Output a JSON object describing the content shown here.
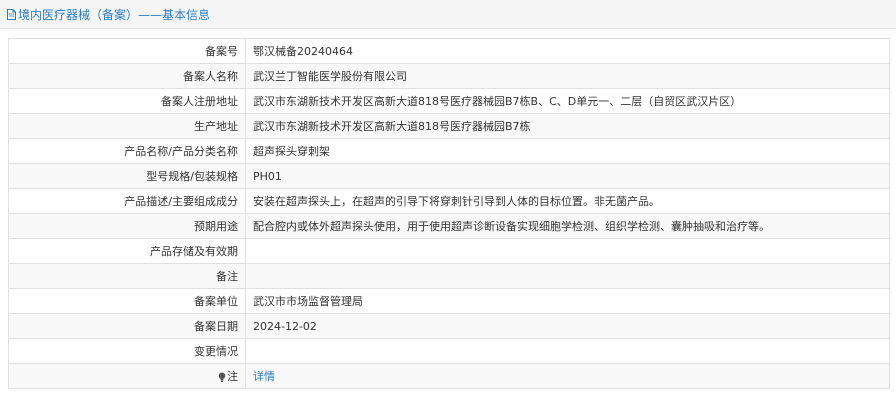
{
  "header": {
    "title": "境内医疗器械（备案）——基本信息",
    "icon": "document-icon",
    "color": "#2a7dc0"
  },
  "fields": {
    "record_no": {
      "label": "备案号",
      "value": "鄂汉械备20240464"
    },
    "filer_name": {
      "label": "备案人名称",
      "value": "武汉兰丁智能医学股份有限公司"
    },
    "filer_address": {
      "label": "备案人注册地址",
      "value": "武汉市东湖新技术开发区高新大道818号医疗器械园B7栋B、C、D单元一、二层（自贸区武汉片区）"
    },
    "production_address": {
      "label": "生产地址",
      "value": "武汉市东湖新技术开发区高新大道818号医疗器械园B7栋"
    },
    "product_name": {
      "label": "产品名称/产品分类名称",
      "value": "超声探头穿刺架"
    },
    "model_spec": {
      "label": "型号规格/包装规格",
      "value": "PH01"
    },
    "description": {
      "label": "产品描述/主要组成成分",
      "value": "安装在超声探头上，在超声的引导下将穿刺针引导到人体的目标位置。非无菌产品。"
    },
    "intended_use": {
      "label": "预期用途",
      "value": "配合腔内或体外超声探头使用，用于使用超声诊断设备实现细胞学检测、组织学检测、囊肿抽吸和治疗等。"
    },
    "storage": {
      "label": "产品存储及有效期",
      "value": ""
    },
    "remarks": {
      "label": "备注",
      "value": ""
    },
    "record_unit": {
      "label": "备案单位",
      "value": "武汉市市场监督管理局"
    },
    "record_date": {
      "label": "备案日期",
      "value": "2024-12-02"
    },
    "changes": {
      "label": "变更情况",
      "value": ""
    },
    "note": {
      "label": "注",
      "value": "详情",
      "icon": "lightbulb-icon"
    }
  }
}
